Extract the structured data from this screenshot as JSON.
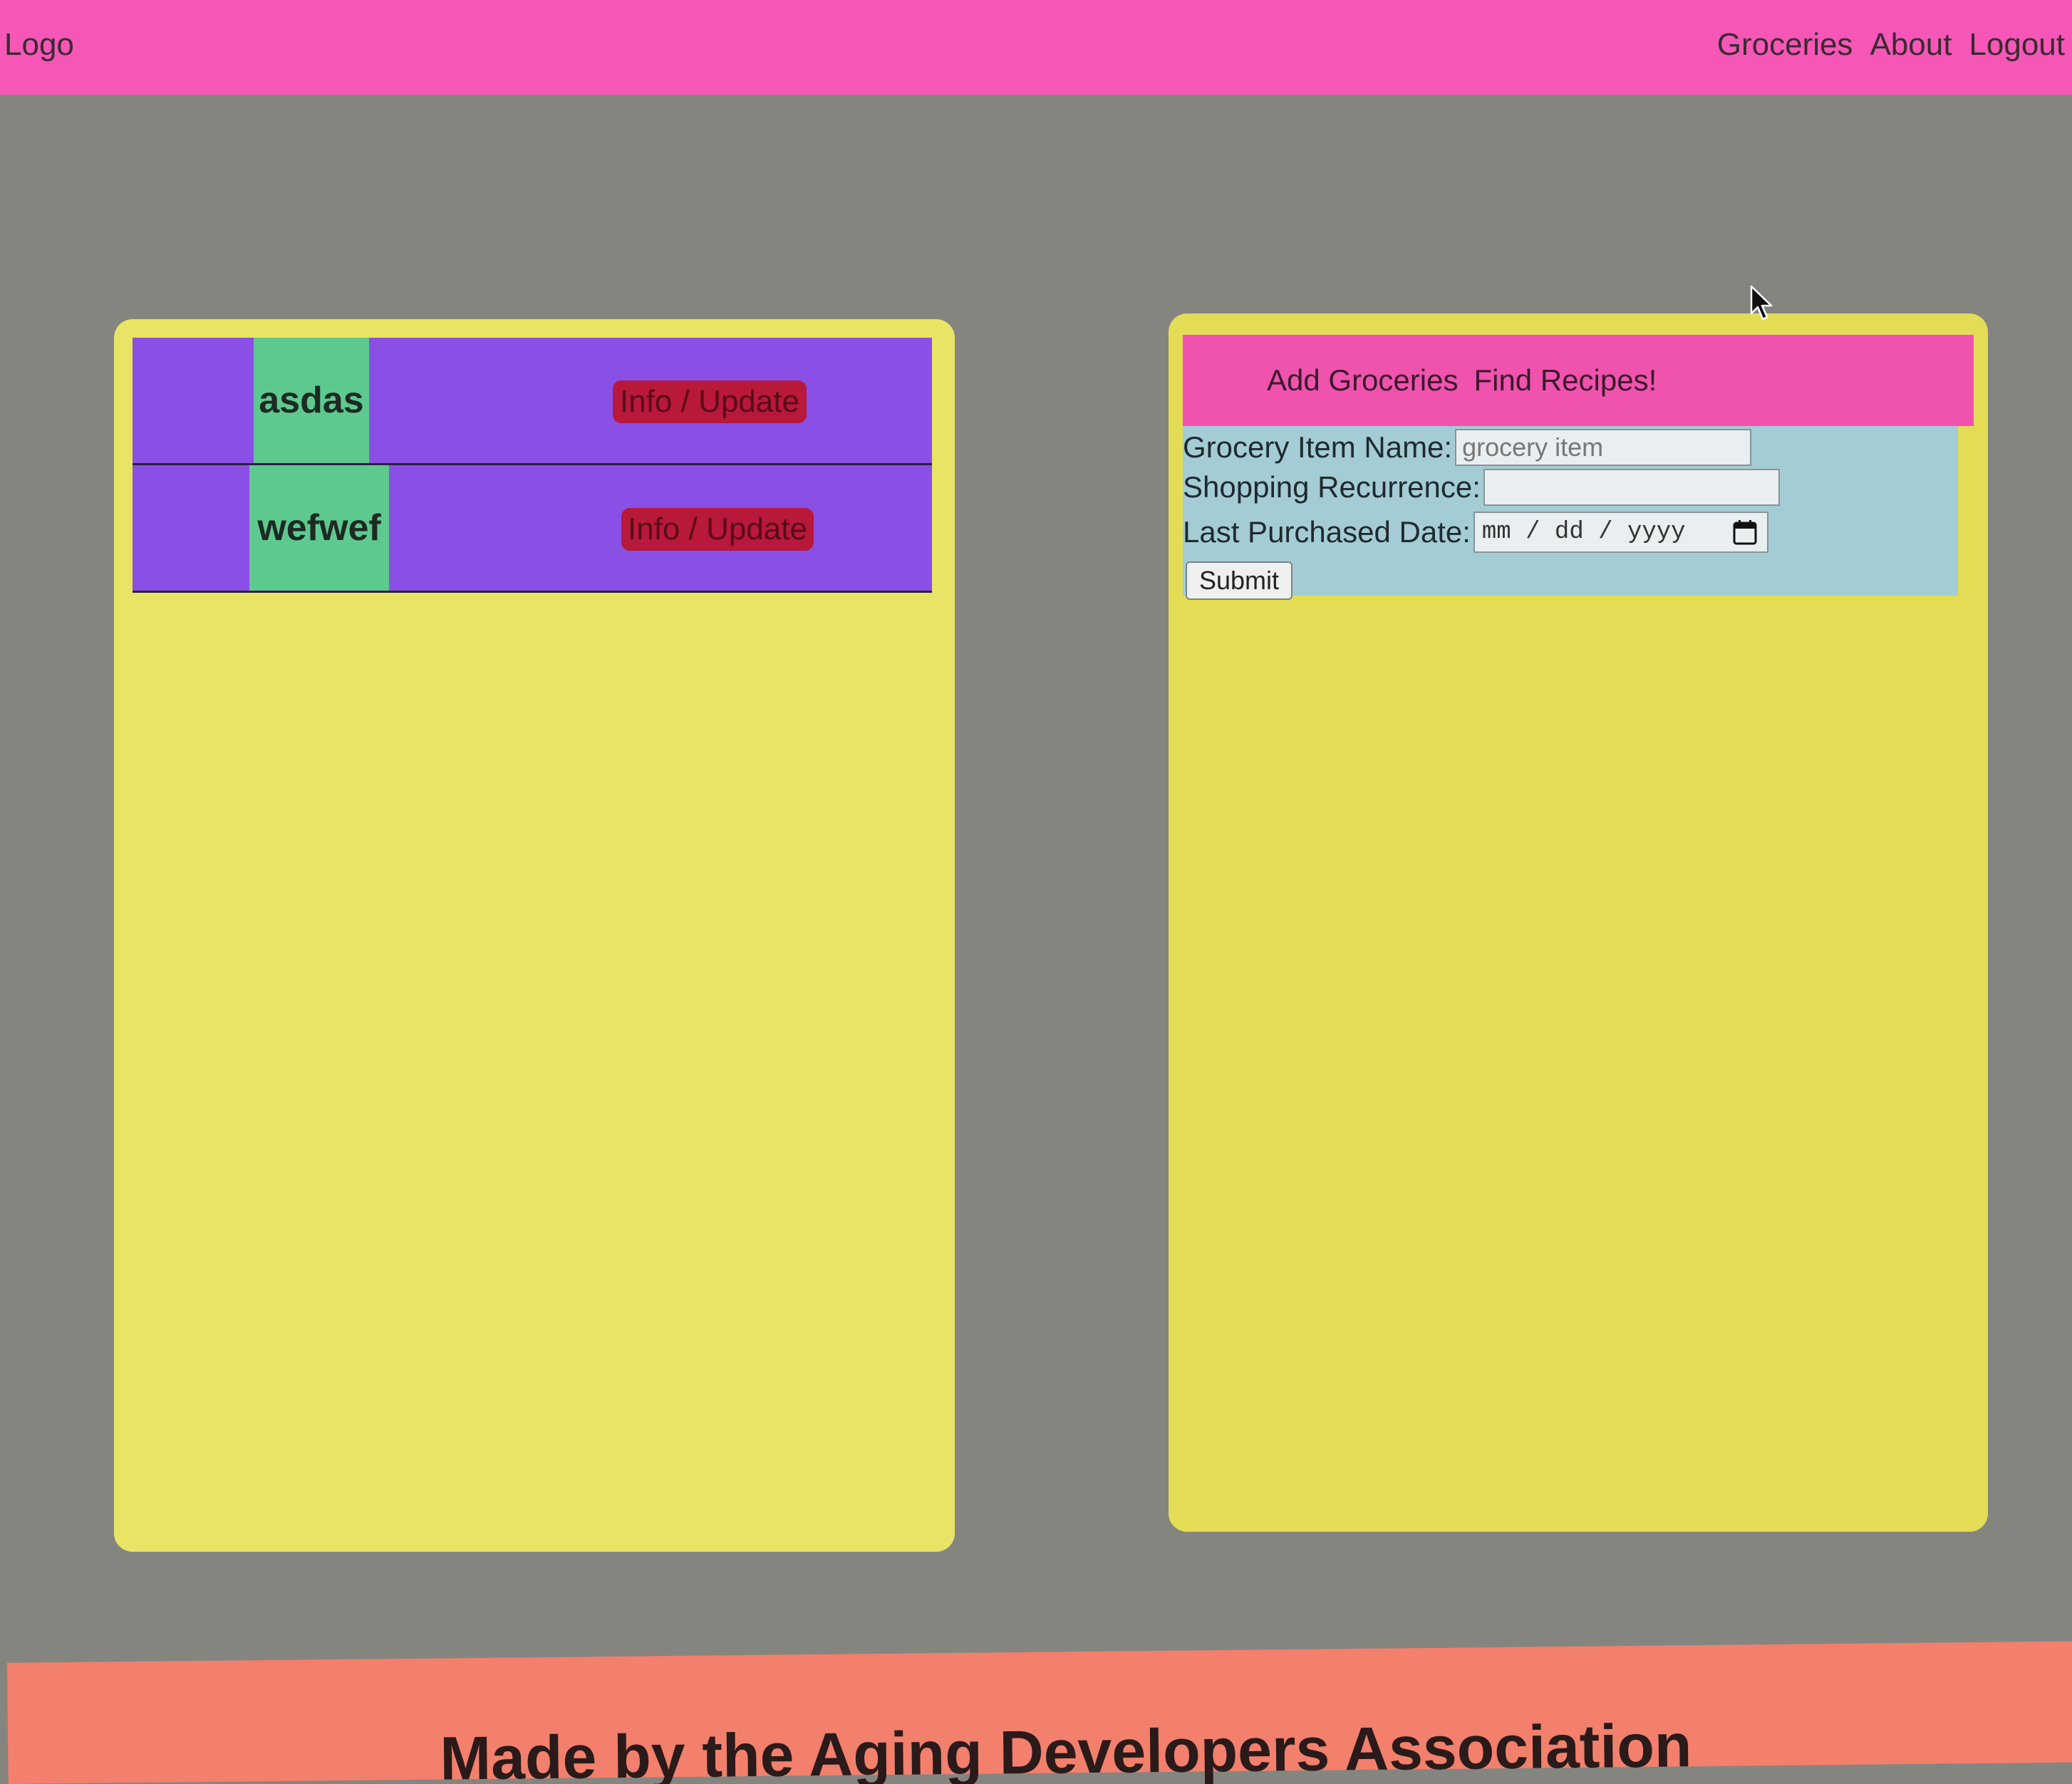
{
  "nav": {
    "logo": "Logo",
    "links": [
      "Groceries",
      "About",
      "Logout"
    ]
  },
  "grocery_list": {
    "items": [
      {
        "name": "asdas",
        "button_label": "Info / Update"
      },
      {
        "name": "wefwef",
        "button_label": "Info / Update"
      }
    ]
  },
  "right_panel": {
    "tabs": [
      "Add Groceries",
      "Find Recipes!"
    ],
    "form": {
      "item_name_label": "Grocery Item Name:",
      "item_name_placeholder": "grocery item",
      "recurrence_label": "Shopping Recurrence:",
      "recurrence_value": "",
      "date_label": "Last Purchased Date:",
      "date_placeholder": "mm / dd / yyyy",
      "submit_label": "Submit"
    }
  },
  "footer": {
    "text": "Made by the Aging Developers Association"
  },
  "colors": {
    "nav_bg": "#f657b6",
    "panel_bg": "#e9e465",
    "row_bg": "#8a4fe4",
    "name_cell_bg": "#5ec98f",
    "button_bg": "#b8183a",
    "form_bg": "#a4ccd4",
    "footer_bg": "#f2806c"
  }
}
